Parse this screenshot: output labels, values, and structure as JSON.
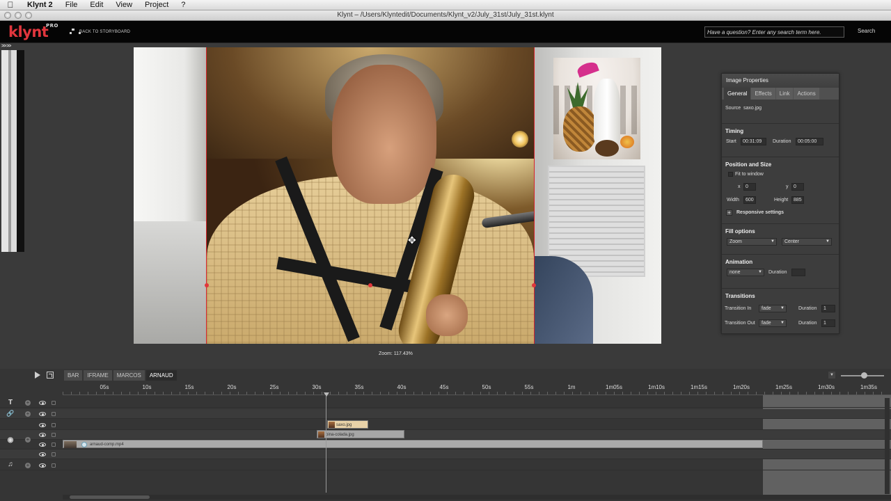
{
  "menubar": {
    "app": "Klynt 2",
    "items": [
      "File",
      "Edit",
      "View",
      "Project",
      "?"
    ]
  },
  "window": {
    "title": "Klynt – /Users/Klyntedit/Documents/Klynt_v2/July_31st/July_31st.klynt"
  },
  "header": {
    "logo": "klynt",
    "logo_badge": "PRO",
    "back_label": "BACK TO STORYBOARD",
    "search_placeholder": "Have a question? Enter any search term here.",
    "search_button": "Search"
  },
  "left_panel": {
    "toggle": ">> >>"
  },
  "stage": {
    "zoom_label": "Zoom: 117.43%"
  },
  "properties": {
    "title": "Image Properties",
    "tabs": [
      "General",
      "Effects",
      "Link",
      "Actions"
    ],
    "active_tab": "General",
    "source_label": "Source",
    "source_value": "saxo.jpg",
    "timing": {
      "title": "Timing",
      "start_label": "Start",
      "start_value": "00:31:09",
      "duration_label": "Duration",
      "duration_value": "00:05:00"
    },
    "position": {
      "title": "Position and Size",
      "fit_label": "Fit to window",
      "x_label": "x",
      "x_value": "0",
      "y_label": "y",
      "y_value": "0",
      "width_label": "Width",
      "width_value": "600",
      "height_label": "Height",
      "height_value": "885",
      "responsive_label": "Responsive settings"
    },
    "fill": {
      "title": "Fill options",
      "mode": "Zoom",
      "align": "Center"
    },
    "animation": {
      "title": "Animation",
      "value": "none",
      "duration_label": "Duration",
      "duration_value": ""
    },
    "transitions": {
      "title": "Transitions",
      "in_label": "Transition In",
      "in_value": "fade",
      "in_duration_label": "Duration",
      "in_duration_value": "1",
      "out_label": "Transition Out",
      "out_value": "fade",
      "out_duration_label": "Duration",
      "out_duration_value": "1"
    }
  },
  "timeline": {
    "tabs": [
      "BAR",
      "IFRAME",
      "MARCOS",
      "ARNAUD"
    ],
    "active_tab": "ARNAUD",
    "ruler": [
      "05s",
      "10s",
      "15s",
      "20s",
      "25s",
      "30s",
      "35s",
      "40s",
      "45s",
      "50s",
      "55s",
      "1m",
      "1m05s",
      "1m10s",
      "1m15s",
      "1m20s",
      "1m25s",
      "1m30s",
      "1m35s"
    ],
    "clips": {
      "saxo": "saxo.jpg",
      "pina": "pina-colada.jpg",
      "video": "arnaud-comp.mp4"
    }
  },
  "icons": {
    "text_track": "text-icon",
    "link_track": "link-icon",
    "image_track": "camera-icon",
    "audio_track": "music-note-icon"
  }
}
